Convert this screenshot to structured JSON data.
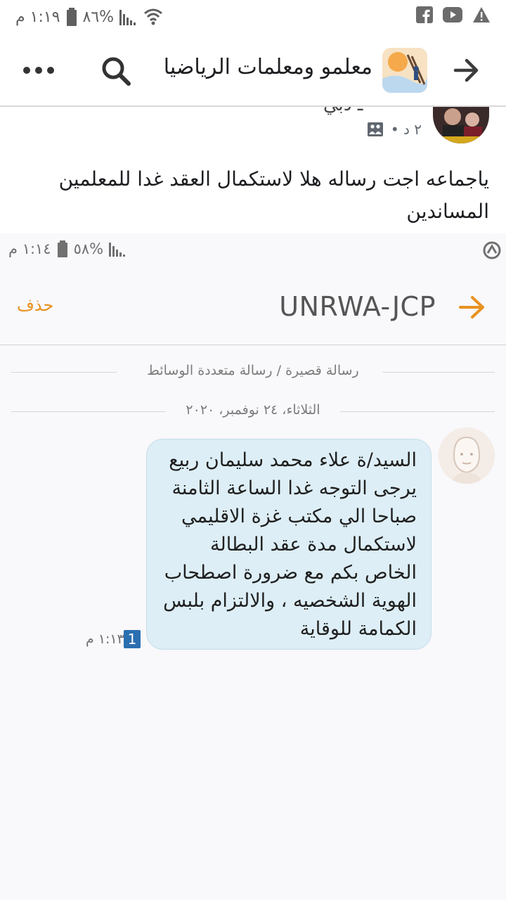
{
  "status_bar": {
    "time": "١:١٩ م",
    "battery": "%٨٦"
  },
  "fb_header": {
    "group_title": "معلمو ومعلمات الرياضيا..."
  },
  "post": {
    "author_name_clip": "ـ دبي",
    "meta": "٢ د •",
    "text": "ياجماعه اجت رساله هلا لاستكمال العقد غدا للمعلمين المساندين"
  },
  "inner_screenshot": {
    "status_bar": {
      "time": "١:١٤ م",
      "battery": "%٥٨"
    },
    "header": {
      "contact": "UNRWA-JCP",
      "delete_label": "حذف"
    },
    "thread_type": "رسالة قصيرة / رسالة متعددة الوسائط",
    "date": "الثلاثاء، ٢٤ نوفمبر، ٢٠٢٠",
    "message": {
      "text": "السيد/ة علاء محمد سليمان ربيع يرجى التوجه غدا الساعة الثامنة صباحا الي مكتب غزة الاقليمي لاستكمال مدة عقد البطالة الخاص بكم مع ضرورة اصطحاب الهوية الشخصيه ، والالتزام بلبس الكمامة للوقاية",
      "sim": "1",
      "time": "١:١٣ م"
    }
  },
  "colors": {
    "accent_orange": "#e89220",
    "bubble_bg": "#ddeef6",
    "sim_badge": "#2a6fb0"
  },
  "icons": [
    "warning-icon",
    "youtube-icon",
    "facebook-icon",
    "battery-icon",
    "signal-icon",
    "wifi-icon",
    "back-arrow-icon",
    "search-icon",
    "more-icon",
    "photos-icon",
    "sync-icon",
    "forward-arrow-icon"
  ]
}
